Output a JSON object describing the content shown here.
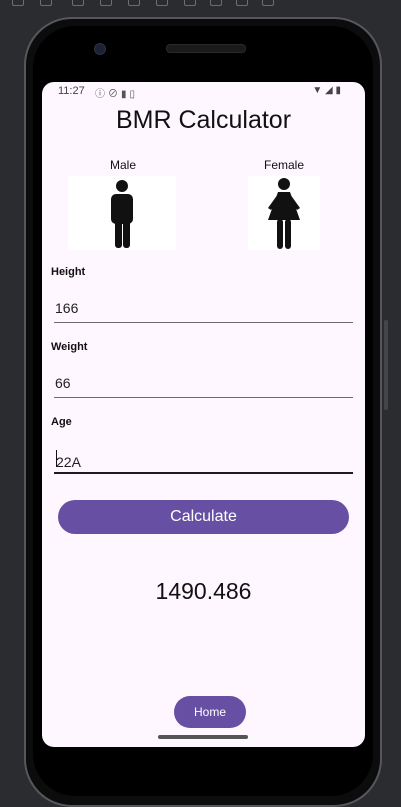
{
  "status_bar": {
    "time": "11:27",
    "left_icons": [
      "info-icon",
      "shield-icon",
      "storage-icon",
      "sd-card-icon"
    ],
    "right_icons": [
      "wifi-icon",
      "cell-signal-icon",
      "battery-icon"
    ]
  },
  "app": {
    "title": "BMR Calculator",
    "gender": {
      "male_label": "Male",
      "female_label": "Female"
    },
    "fields": {
      "height": {
        "label": "Height",
        "value": "166"
      },
      "weight": {
        "label": "Weight",
        "value": "66"
      },
      "age": {
        "label": "Age",
        "value": "22A"
      }
    },
    "calculate_label": "Calculate",
    "result": "1490.486",
    "home_label": "Home"
  },
  "colors": {
    "accent": "#6750a4",
    "screen_bg": "#fef7ff",
    "frame": "#0c0c0d"
  }
}
